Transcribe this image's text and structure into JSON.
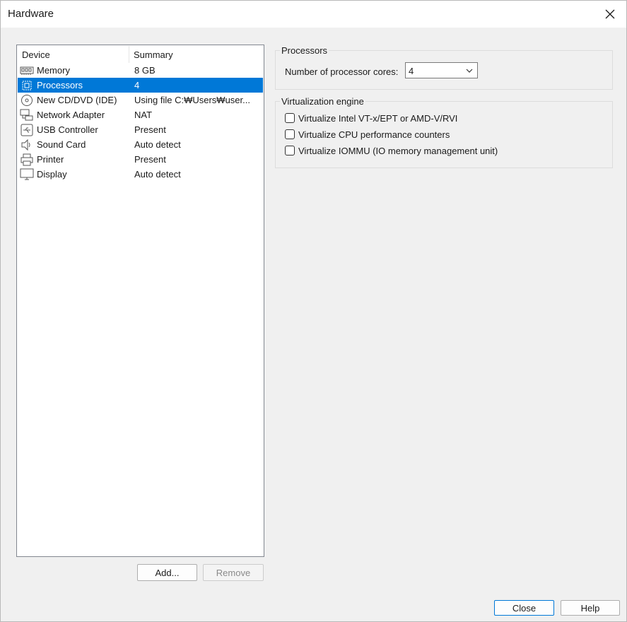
{
  "window": {
    "title": "Hardware"
  },
  "device_list": {
    "columns": [
      "Device",
      "Summary"
    ],
    "rows": [
      {
        "icon": "memory-icon",
        "device": "Memory",
        "summary": "8 GB",
        "selected": false
      },
      {
        "icon": "processor-icon",
        "device": "Processors",
        "summary": "4",
        "selected": true
      },
      {
        "icon": "cd-dvd-icon",
        "device": "New CD/DVD (IDE)",
        "summary": "Using file C:₩Users₩user...",
        "selected": false
      },
      {
        "icon": "network-adapter-icon",
        "device": "Network Adapter",
        "summary": "NAT",
        "selected": false
      },
      {
        "icon": "usb-icon",
        "device": "USB Controller",
        "summary": "Present",
        "selected": false
      },
      {
        "icon": "speaker-icon",
        "device": "Sound Card",
        "summary": "Auto detect",
        "selected": false
      },
      {
        "icon": "printer-icon",
        "device": "Printer",
        "summary": "Present",
        "selected": false
      },
      {
        "icon": "display-icon",
        "device": "Display",
        "summary": "Auto detect",
        "selected": false
      }
    ]
  },
  "list_buttons": {
    "add": "Add...",
    "remove": "Remove",
    "remove_enabled": false
  },
  "processors": {
    "group_title": "Processors",
    "cores_label": "Number of processor cores:",
    "cores_value": "4"
  },
  "virtualization": {
    "group_title": "Virtualization engine",
    "options": [
      {
        "label": "Virtualize Intel VT-x/EPT or AMD-V/RVI",
        "checked": false
      },
      {
        "label": "Virtualize CPU performance counters",
        "checked": false
      },
      {
        "label": "Virtualize IOMMU (IO memory management unit)",
        "checked": false
      }
    ]
  },
  "footer": {
    "close": "Close",
    "help": "Help"
  },
  "colors": {
    "selection": "#0078d7",
    "dialog_bg": "#f0f0f0"
  }
}
